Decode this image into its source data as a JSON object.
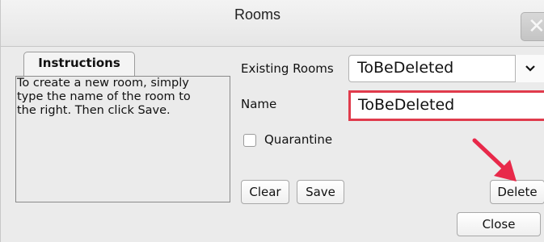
{
  "window": {
    "title": "Rooms",
    "close_glyph": "✕"
  },
  "instructions": {
    "tab_label": "Instructions",
    "lines": [
      "To create a new room, simply",
      "type the name of the room to",
      "the right. Then click Save."
    ]
  },
  "form": {
    "existing_rooms_label": "Existing Rooms",
    "existing_rooms_value": "ToBeDeleted",
    "name_label": "Name",
    "name_value": "ToBeDeleted",
    "quarantine_label": "Quarantine",
    "quarantine_checked": false
  },
  "buttons": {
    "clear": "Clear",
    "save": "Save",
    "delete": "Delete",
    "close": "Close"
  },
  "colors": {
    "highlight": "#e03b4c",
    "annotation_arrow": "#e8294a"
  },
  "icons": {
    "close": "close-icon",
    "dropdown": "chevron-down-icon",
    "annotation": "arrow-annotation-icon"
  }
}
